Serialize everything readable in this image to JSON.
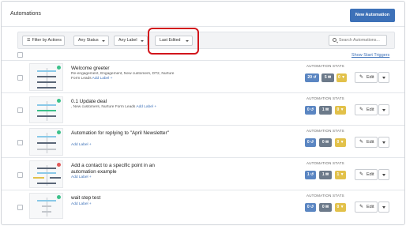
{
  "header": {
    "title": "Automations",
    "new_button": "New Automation"
  },
  "filters": {
    "filter_by_actions": "Filter by Actions",
    "status": "Any Status",
    "label": "Any Label",
    "sort": "Last Edited",
    "search_placeholder": "Search Automations..."
  },
  "list": {
    "show_triggers": "Show Start Triggers",
    "stats_label": "AUTOMATION STATS",
    "edit_label": "Edit"
  },
  "rows": [
    {
      "name": "Welcome greeter",
      "tags": "Re-engagement, Engagement, New customers, DT2, Nurture Form Leads",
      "add_label": "Add Label +",
      "stats": [
        "20",
        "5",
        "0"
      ]
    },
    {
      "name": "0.1 Update deal",
      "tags": ", New customers, Nurture Form Leads",
      "add_label": "Add Label +",
      "stats": [
        "0",
        "1",
        "0"
      ]
    },
    {
      "name": "Automation for replying to \"April Newsletter\"",
      "tags": "",
      "add_label": "Add Label +",
      "stats": [
        "0",
        "0",
        "0"
      ]
    },
    {
      "name": "Add a contact to a specific point in an automation example",
      "tags": "",
      "add_label": "Add Label +",
      "stats": [
        "1",
        "1",
        "1"
      ]
    },
    {
      "name": "wait step test",
      "tags": "",
      "add_label": "Add Label +",
      "stats": [
        "0",
        "0",
        "0"
      ]
    }
  ],
  "colors": {
    "accent": "#3d71b8",
    "highlight": "#d2151b",
    "stat_blue": "#5b86c2",
    "stat_slate": "#6c7a8a",
    "stat_yellow": "#e2c14a"
  }
}
